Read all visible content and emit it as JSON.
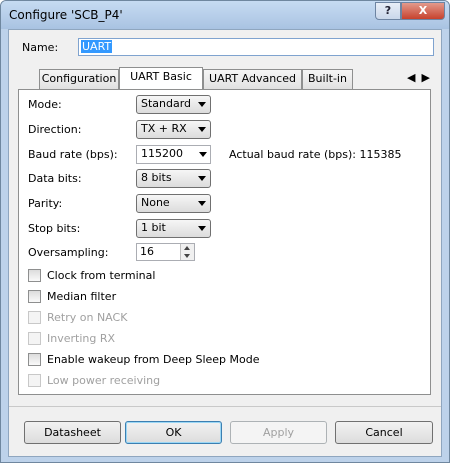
{
  "window": {
    "title": "Configure 'SCB_P4'",
    "help_label": "?",
    "close_label": "X"
  },
  "name": {
    "label": "Name:",
    "value": "UART"
  },
  "tabs": [
    {
      "label": "Configuration"
    },
    {
      "label": "UART Basic"
    },
    {
      "label": "UART Advanced"
    },
    {
      "label": "Built-in"
    }
  ],
  "tab_scroll": {
    "left": "◀",
    "right": "▶"
  },
  "active_tab": "UART Basic",
  "fields": {
    "mode": {
      "label": "Mode:",
      "value": "Standard"
    },
    "direction": {
      "label": "Direction:",
      "value": "TX + RX"
    },
    "baud_rate": {
      "label": "Baud rate (bps):",
      "value": "115200",
      "actual_label": "Actual baud rate (bps): 115385"
    },
    "data_bits": {
      "label": "Data bits:",
      "value": "8 bits"
    },
    "parity": {
      "label": "Parity:",
      "value": "None"
    },
    "stop_bits": {
      "label": "Stop bits:",
      "value": "1 bit"
    },
    "oversampling": {
      "label": "Oversampling:",
      "value": "16"
    }
  },
  "checkboxes": [
    {
      "label": "Clock from terminal",
      "checked": false,
      "enabled": true
    },
    {
      "label": "Median filter",
      "checked": false,
      "enabled": true
    },
    {
      "label": "Retry on NACK",
      "checked": false,
      "enabled": false
    },
    {
      "label": "Inverting RX",
      "checked": false,
      "enabled": false
    },
    {
      "label": "Enable wakeup from Deep Sleep Mode",
      "checked": false,
      "enabled": true
    },
    {
      "label": "Low power receiving",
      "checked": false,
      "enabled": false
    }
  ],
  "buttons": {
    "datasheet": "Datasheet",
    "ok": "OK",
    "apply": "Apply",
    "cancel": "Cancel"
  }
}
